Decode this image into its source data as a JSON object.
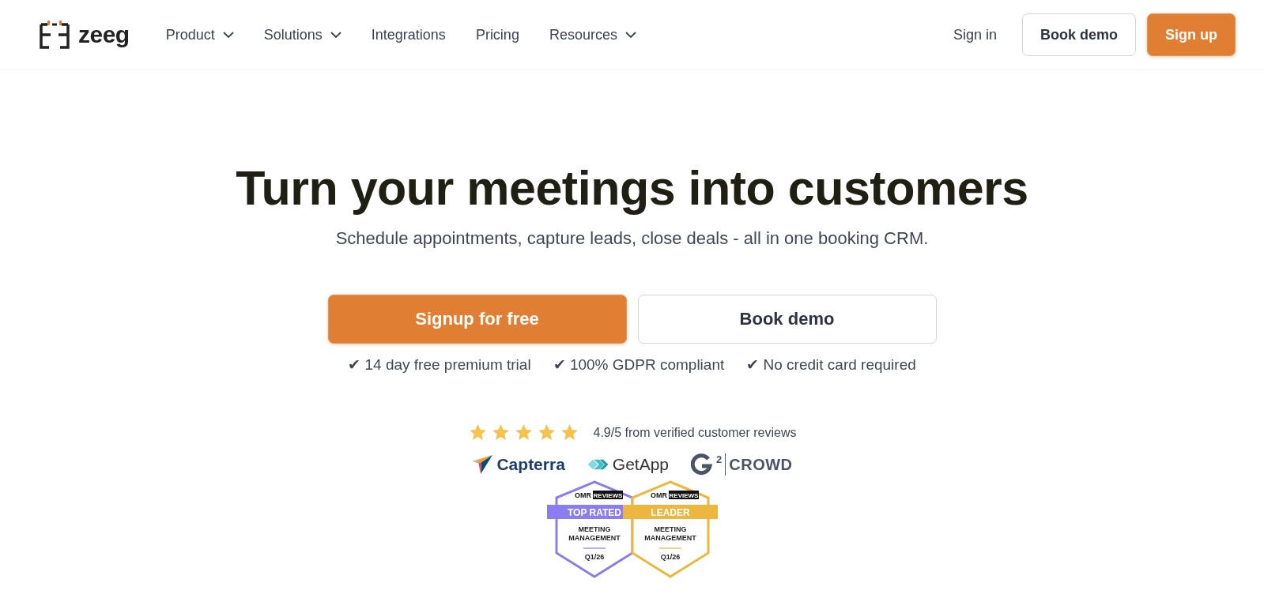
{
  "header": {
    "logo": "zeeg",
    "nav": [
      {
        "label": "Product",
        "dropdown": true
      },
      {
        "label": "Solutions",
        "dropdown": true
      },
      {
        "label": "Integrations",
        "dropdown": false
      },
      {
        "label": "Pricing",
        "dropdown": false
      },
      {
        "label": "Resources",
        "dropdown": true
      }
    ],
    "sign_in": "Sign in",
    "book_demo": "Book demo",
    "sign_up": "Sign up"
  },
  "hero": {
    "title": "Turn your meetings into customers",
    "subtitle": "Schedule appointments, capture leads, close deals - all in one booking CRM.",
    "primary_button": "Signup for free",
    "secondary_button": "Book demo",
    "benefits": [
      "✔ 14 day free premium trial",
      "✔ 100% GDPR compliant",
      "✔ No credit card required"
    ]
  },
  "reviews": {
    "stars": 5,
    "summary": "4.9/5 from verified customer reviews",
    "platforms": [
      {
        "kind": "capterra",
        "name": "Capterra"
      },
      {
        "kind": "getapp",
        "name": "GetApp"
      },
      {
        "kind": "g2",
        "mark": "2",
        "name": "CROWD"
      }
    ],
    "badges": [
      {
        "brand": "OMR",
        "brand_tag": "REVIEWS",
        "title": "TOP RATED",
        "category": [
          "MEETING",
          "MANAGEMENT"
        ],
        "period": "Q1/26",
        "color": "#8b7cf0"
      },
      {
        "brand": "OMR",
        "brand_tag": "REVIEWS",
        "title": "LEADER",
        "category": [
          "MEETING",
          "MANAGEMENT"
        ],
        "period": "Q1/26",
        "color": "#ecb63f"
      }
    ]
  }
}
